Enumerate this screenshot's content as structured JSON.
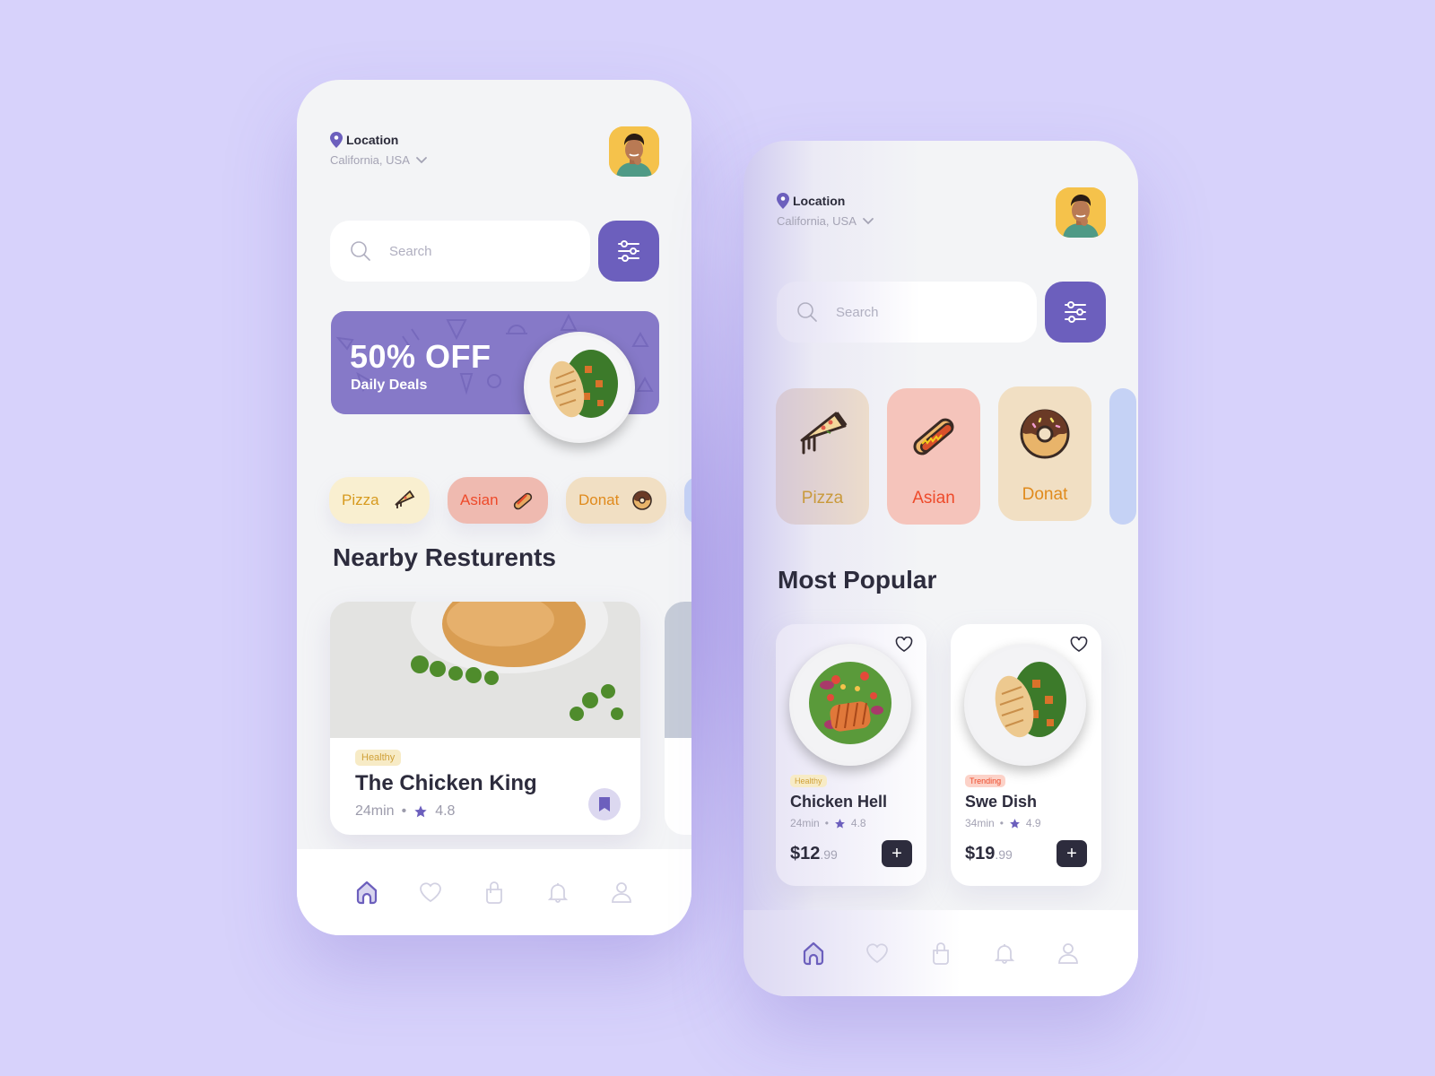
{
  "colors": {
    "background": "#d7d2fb",
    "accent": "#6c5fbd",
    "promo": "#8679c8",
    "text_dark": "#2d2c3d",
    "text_muted": "#a4a3b4"
  },
  "screen_home": {
    "location": {
      "label": "Location",
      "value": "California, USA"
    },
    "search": {
      "placeholder": "Search",
      "value": ""
    },
    "promo": {
      "title": "50% OFF",
      "subtitle": "Daily Deals"
    },
    "categories": [
      {
        "label": "Pizza",
        "icon": "pizza-icon"
      },
      {
        "label": "Asian",
        "icon": "hotdog-icon"
      },
      {
        "label": "Donat",
        "icon": "donut-icon"
      }
    ],
    "section_title": "Nearby Resturents",
    "restaurants": [
      {
        "tag": "Healthy",
        "name": "The Chicken King",
        "time": "24min",
        "separator": "•",
        "rating": "4.8",
        "bookmarked": true
      }
    ],
    "tabs": [
      {
        "name": "home",
        "icon": "home-icon",
        "active": true
      },
      {
        "name": "favorites",
        "icon": "heart-icon",
        "active": false
      },
      {
        "name": "cart",
        "icon": "bag-icon",
        "active": false
      },
      {
        "name": "notifications",
        "icon": "bell-icon",
        "active": false
      },
      {
        "name": "profile",
        "icon": "user-icon",
        "active": false
      }
    ]
  },
  "screen_popular": {
    "location": {
      "label": "Location",
      "value": "California, USA"
    },
    "search": {
      "placeholder": "Search",
      "value": ""
    },
    "categories": [
      {
        "label": "Pizza",
        "icon": "pizza-icon"
      },
      {
        "label": "Asian",
        "icon": "hotdog-icon"
      },
      {
        "label": "Donat",
        "icon": "donut-icon"
      }
    ],
    "section_title": "Most Popular",
    "dishes": [
      {
        "tag": "Healthy",
        "name": "Chicken Hell",
        "time": "24min",
        "separator": "•",
        "rating": "4.8",
        "price_main": "$12",
        "price_cents": ".99"
      },
      {
        "tag": "Trending",
        "name": "Swe Dish",
        "time": "34min",
        "separator": "•",
        "rating": "4.9",
        "price_main": "$19",
        "price_cents": ".99"
      }
    ],
    "add_label": "+"
  }
}
